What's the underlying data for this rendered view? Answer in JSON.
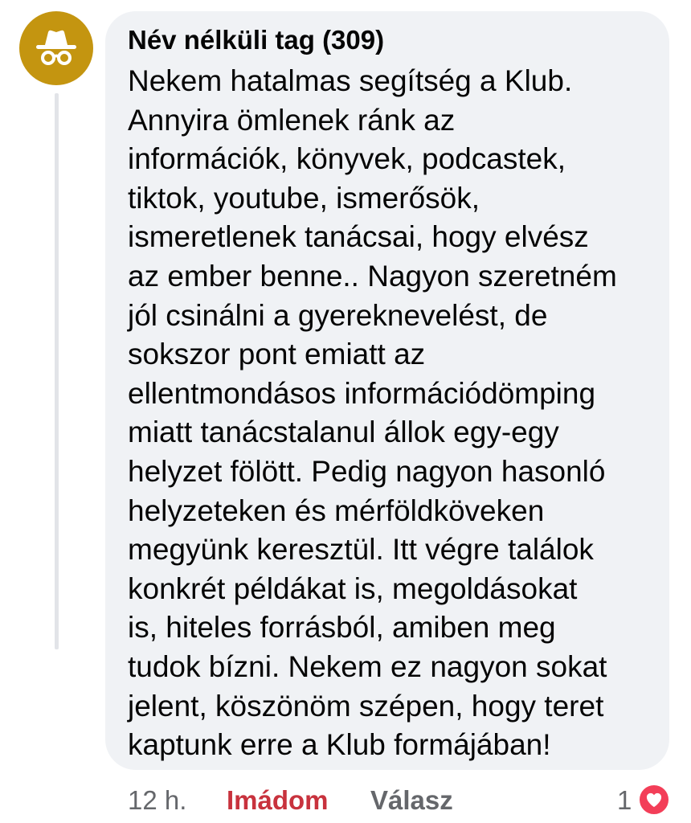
{
  "comment": {
    "avatar_icon": "incognito-icon",
    "author": "Név nélküli tag (309)",
    "text": "Nekem hatalmas segítség a Klub.\nAnnyira ömlenek ránk az\ninformációk, könyvek, podcastek,\ntiktok, youtube, ismerősök,\nismeretlenek tanácsai, hogy elvész\naz ember benne.. Nagyon szeretném\njól csinálni a gyereknevelést, de\nsokszor pont emiatt az\nellentmondásos információdömping\nmiatt tanácstalanul állok egy-egy\nhelyzet fölött. Pedig nagyon hasonló\nhelyzeteken és mérföldköveken\nmegyünk keresztül. Itt végre találok\nkonkrét példákat is, megoldásokat\nis, hiteles forrásból, amiben meg\ntudok bízni. Nekem ez nagyon sokat\njelent, köszönöm szépen, hogy teret\nkaptunk erre a Klub formájában!"
  },
  "actions": {
    "timestamp": "12 h.",
    "love_label": "Imádom",
    "reply_label": "Válasz",
    "reaction_count": "1",
    "reaction_icon": "heart-icon"
  },
  "colors": {
    "avatar_bg": "#c49510",
    "bubble_bg": "#f0f2f5",
    "love_active": "#c8323d",
    "heart_badge": "#f33e58",
    "muted_text": "#65676b"
  }
}
